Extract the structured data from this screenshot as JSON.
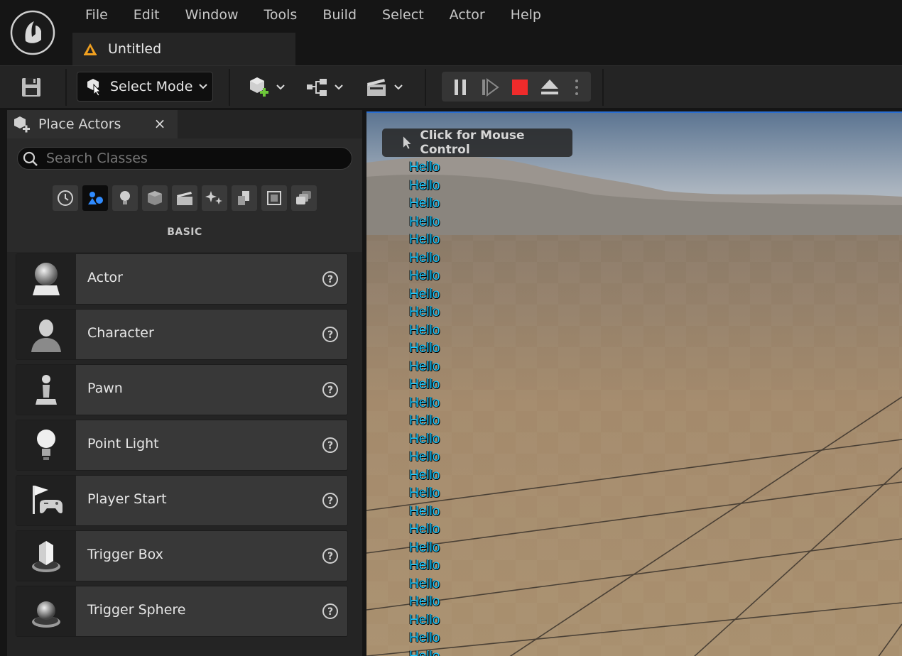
{
  "app": {
    "logo_icon": "unreal-engine-logo-icon",
    "menu": [
      "File",
      "Edit",
      "Window",
      "Tools",
      "Build",
      "Select",
      "Actor",
      "Help"
    ],
    "document_tab": {
      "label": "Untitled",
      "icon": "level-warning-icon"
    }
  },
  "toolbar": {
    "save_icon": "save-icon",
    "select_mode_label": "Select Mode",
    "quick_add_icon": "quick-add-icon",
    "blueprint_icon": "blueprint-icon",
    "cinematics_icon": "cinematics-icon",
    "play_controls": [
      "pause",
      "step-frame",
      "stop",
      "eject"
    ]
  },
  "place_actors": {
    "tab_label": "Place Actors",
    "close_glyph": "×",
    "search_placeholder": "Search Classes",
    "categories": [
      "recent",
      "basic",
      "lights",
      "shapes",
      "cinematic",
      "visual-effects",
      "geometry",
      "volumes",
      "all-classes"
    ],
    "active_category": "BASIC",
    "items": [
      {
        "label": "Actor",
        "icon": "actor-sphere-icon"
      },
      {
        "label": "Character",
        "icon": "character-icon"
      },
      {
        "label": "Pawn",
        "icon": "pawn-icon"
      },
      {
        "label": "Point Light",
        "icon": "point-light-icon"
      },
      {
        "label": "Player Start",
        "icon": "player-start-icon"
      },
      {
        "label": "Trigger Box",
        "icon": "trigger-box-icon"
      },
      {
        "label": "Trigger Sphere",
        "icon": "trigger-sphere-icon"
      }
    ]
  },
  "viewport": {
    "mouse_control_label": "Click for Mouse Control",
    "debug_messages": [
      "Hello",
      "Hello",
      "Hello",
      "Hello",
      "Hello",
      "Hello",
      "Hello",
      "Hello",
      "Hello",
      "Hello",
      "Hello",
      "Hello",
      "Hello",
      "Hello",
      "Hello",
      "Hello",
      "Hello",
      "Hello",
      "Hello",
      "Hello",
      "Hello",
      "Hello",
      "Hello",
      "Hello",
      "Hello",
      "Hello",
      "Hello",
      "Hello"
    ],
    "accent_color": "#1ac8ff"
  }
}
